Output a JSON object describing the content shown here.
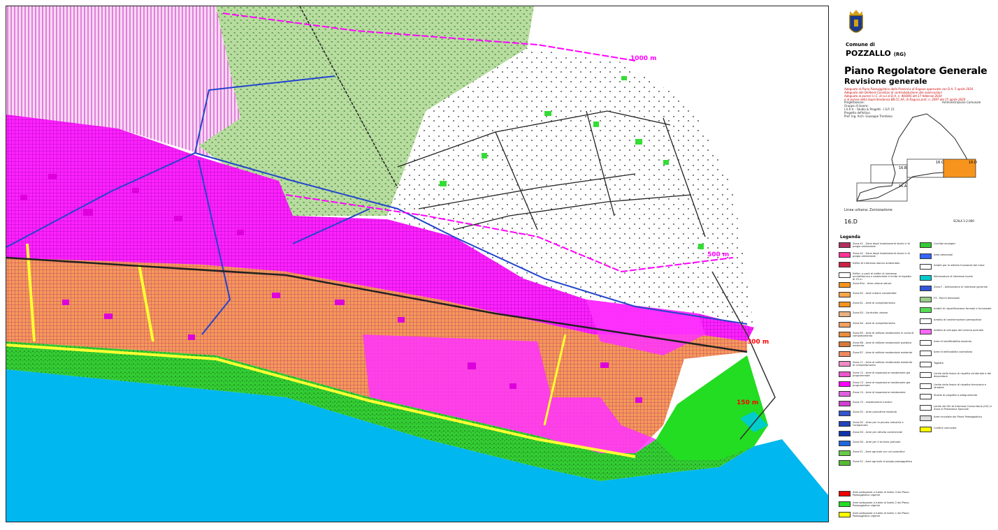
{
  "map": {
    "contours": [
      {
        "label": "1000 m"
      },
      {
        "label": "500 m"
      },
      {
        "label": "300 m"
      },
      {
        "label": "150 m"
      }
    ]
  },
  "sidebar": {
    "crest_icon": "municipal-crest-icon",
    "comune_di": "Comune di",
    "comune_name": "POZZALLO",
    "province": "(RG)",
    "title": "Piano Regolatore Generale",
    "subtitle": "Revisione generale",
    "notes": [
      "Adeguato al Piano Paesaggistico della Provincia di Ragusa approvato con D.A. 5 aprile 2016",
      "Adeguato alle Delibere Consiliari di controdeduzione alle osservazioni",
      "Adeguato al parere I.I.C. di cui al D.A. n. 40/DRS del 17 febbraio 2020",
      "e al parere della Soprintendenza BB.CC.AA. di Ragusa prot. n. 2097 del 15 aprile 2020"
    ],
    "credits": {
      "heading": "Progettazione:",
      "team_label": "Gruppo di lavoro:",
      "team": "I.U.A.V. - Studio & Progetti - I.S.P. 21",
      "author_label": "Progetto definitivo",
      "author": "Prof. Ing. Arch. Giuseppe Trombino",
      "admin": "Amministrazione Comunale"
    },
    "keymap": {
      "sheets": [
        "16.B",
        "16.C",
        "16.D",
        "16.A"
      ],
      "highlight_color": "#f7941d"
    },
    "key_caption": "Linea urbana: Zonizzazione",
    "sheet_code": "16.D",
    "scale": "SCALA 1:2.000",
    "legend_title": "Legenda"
  },
  "legend": {
    "left": [
      {
        "label": "Zona A1 - Zone degli insediamenti storici e di pregio ambientale",
        "color": "#b03060"
      },
      {
        "label": "Zona A2 - Zone degli insediamenti storici e di pregio ambientale",
        "color": "#ff3399"
      },
      {
        "label": "Edifici di interesse storico ambientale",
        "color": "#cc2244"
      },
      {
        "label": "Edifici, o parti di edifici di interesse architettonico e ambientale e limite di rispetto di 25 m",
        "color": "#ffffff"
      },
      {
        "label": "Zona B1a - Aree urbane sature",
        "color": "#f7941d"
      },
      {
        "label": "Zona B2 - Aree urbane consolidate",
        "color": "#f5a54a"
      },
      {
        "label": "Zona B1 - Aree di completamento",
        "color": "#f7941d"
      },
      {
        "label": "Zona B3 - Centralita urbane",
        "color": "#e8b080"
      },
      {
        "label": "Zona B4 - Aree di completamento",
        "color": "#f2a060"
      },
      {
        "label": "Zona B5 - Aree di edilizia residenziale in corso di completamento",
        "color": "#ea8c40"
      },
      {
        "label": "Zona B6 - Aree di edilizia residenziale pubblica esistente",
        "color": "#d87838"
      },
      {
        "label": "Zona B7 - Aree di edilizia residenziale esistente",
        "color": "#f08a60"
      },
      {
        "label": "Zona C1 - Aree di edilizia residenziale esistente di completamento",
        "color": "#f08ac8"
      },
      {
        "label": "Zona C2 - Aree di espansione residenziale gia programmate",
        "color": "#ee55cc"
      },
      {
        "label": "Zona C3 - Aree di espansione residenziale gia programmate",
        "color": "#ff00ff"
      },
      {
        "label": "Zona C4 - Aree di espansione residenziale",
        "color": "#e060e0"
      },
      {
        "label": "Zona C5 - Insediamenti turistici",
        "color": "#d040d0"
      },
      {
        "label": "Zona D1 - Aree produttive esistenti",
        "color": "#3355cc"
      },
      {
        "label": "Zona D2 - Aree per la piccola industria e l'artigianato",
        "color": "#2244bb"
      },
      {
        "label": "Zona D3 - Aree per attivita commerciali",
        "color": "#1133aa"
      },
      {
        "label": "Zona D4 - Aree per il turismo portuale",
        "color": "#2266dd"
      },
      {
        "label": "Zona E1 - Aree agricole con usi produttivi",
        "color": "#66cc44"
      },
      {
        "label": "Zona E2 - Aree agricole di pregio paesaggistico",
        "color": "#55bb33"
      }
    ],
    "right": [
      {
        "label": "Corridoi ecologici",
        "color": "#33cc33"
      },
      {
        "label": "Aree demaniali",
        "color": "#3366ff"
      },
      {
        "label": "Ambiti per le attivita funzionali del mare",
        "color": "#ffffff"
      },
      {
        "label": "Attrezzature di interesse locale",
        "color": "#00cccc"
      },
      {
        "label": "Zona F - Attrezzature di interesse generale",
        "color": "#3355dd"
      },
      {
        "label": "F3 - Parchi attrezzati",
        "color": "#99cc88"
      },
      {
        "label": "Ambiti di riqualificazione formale e funzionale",
        "color": "#55dd55"
      },
      {
        "label": "Ambito di trasformazione perequativa",
        "color": "#ffffff"
      },
      {
        "label": "Ambito di sviluppo del turismo portuale",
        "color": "#ff66ff"
      },
      {
        "label": "Aree di inedificabilita assoluta",
        "color": "#ffffff"
      },
      {
        "label": "Aree di edificabilita controllata",
        "color": "#ffffff"
      },
      {
        "label": "Tagliate",
        "color": "#ffffff"
      },
      {
        "label": "Limite della fascia di rispetto cimiteriale e del depuratore",
        "color": "#ffffff"
      },
      {
        "label": "Limite della fascia di rispetto ferroviaria e stradale",
        "color": "#ffffff"
      },
      {
        "label": "Strade di progetto e adeguamento",
        "color": "#ffffff"
      },
      {
        "label": "Limite dei Siti di Interesse Comunitario (SIC) e Zona di Protezione Speciale",
        "color": "#ffffff"
      },
      {
        "label": "Aree vincolate dal Piano Paesaggistico",
        "color": "#dddddd"
      },
      {
        "label": "Confine comunale",
        "color": "#ffff00"
      }
    ],
    "bottom": [
      {
        "label": "Aree sottoposte a tutela di livello 3 del Piano Paesaggistico vigente",
        "color": "#ee0000"
      },
      {
        "label": "Aree sottoposte a tutela di livello 2 del Piano Paesaggistico vigente",
        "color": "#22dd22"
      },
      {
        "label": "Aree sottoposte a tutela di livello 1 del Piano Paesaggistico vigente",
        "color": "#ffff00"
      }
    ]
  },
  "colors": {
    "sea": "#00b7ef",
    "coast_green": "#22cc22",
    "magenta_zone": "#ff00ff",
    "orange_zone": "#f7941d",
    "pink_zone": "#ff99ee",
    "agri_green": "#a8d08d",
    "road_yellow": "#ffff33",
    "road_blue": "#2244cc"
  }
}
